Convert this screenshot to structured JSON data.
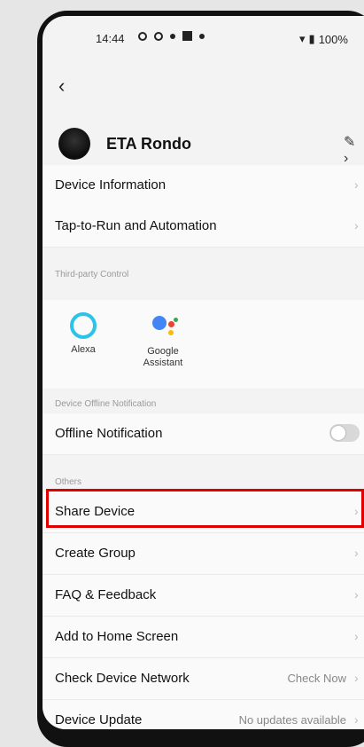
{
  "status_bar": {
    "time": "14:44",
    "battery": "100%"
  },
  "device": {
    "name": "ETA Rondo"
  },
  "menu": {
    "device_information": "Device Information",
    "tap_to_run": "Tap-to-Run and Automation",
    "third_party_section": "Third-party Control",
    "alexa": "Alexa",
    "google_assistant": "Google Assistant",
    "offline_section": "Device Offline Notification",
    "offline_notification": "Offline Notification",
    "others_section": "Others",
    "share_device": "Share Device",
    "create_group": "Create Group",
    "faq_feedback": "FAQ & Feedback",
    "add_home_screen": "Add to Home Screen",
    "check_network": "Check Device Network",
    "check_network_value": "Check Now",
    "device_update": "Device Update",
    "device_update_value": "No updates available"
  },
  "offline_toggle": {
    "state": "off"
  },
  "colors": {
    "highlight": "#e00000",
    "alexa": "#2cc3e8"
  }
}
